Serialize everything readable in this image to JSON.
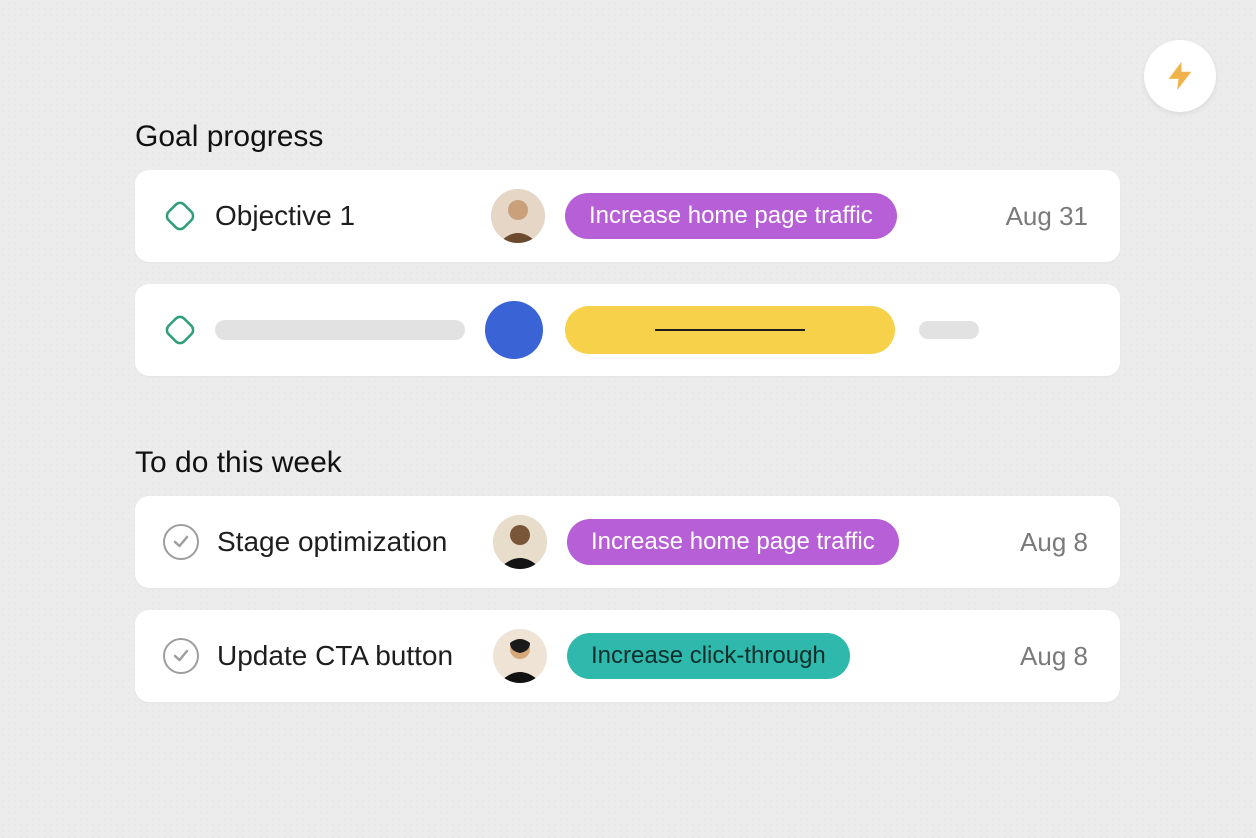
{
  "sections": {
    "goal_progress": {
      "title": "Goal progress",
      "rows": [
        {
          "icon": "diamond",
          "title": "Objective 1",
          "avatar_color": "#c9a98f",
          "tag": {
            "label": "Increase home page traffic",
            "color": "purple"
          },
          "date": "Aug 31"
        }
      ]
    },
    "todo_week": {
      "title": "To do this week",
      "rows": [
        {
          "icon": "check",
          "title": "Stage optimization",
          "avatar_color": "#4a3521",
          "tag": {
            "label": "Increase home page traffic",
            "color": "purple"
          },
          "date": "Aug 8"
        },
        {
          "icon": "check",
          "title": "Update CTA button",
          "avatar_color": "#1a1a1a",
          "tag": {
            "label": "Increase click-through",
            "color": "teal"
          },
          "date": "Aug 8"
        }
      ]
    }
  },
  "colors": {
    "purple": "#b65fd6",
    "teal": "#2fb8ac",
    "yellow": "#f7d14a",
    "blue": "#3a63d6"
  }
}
